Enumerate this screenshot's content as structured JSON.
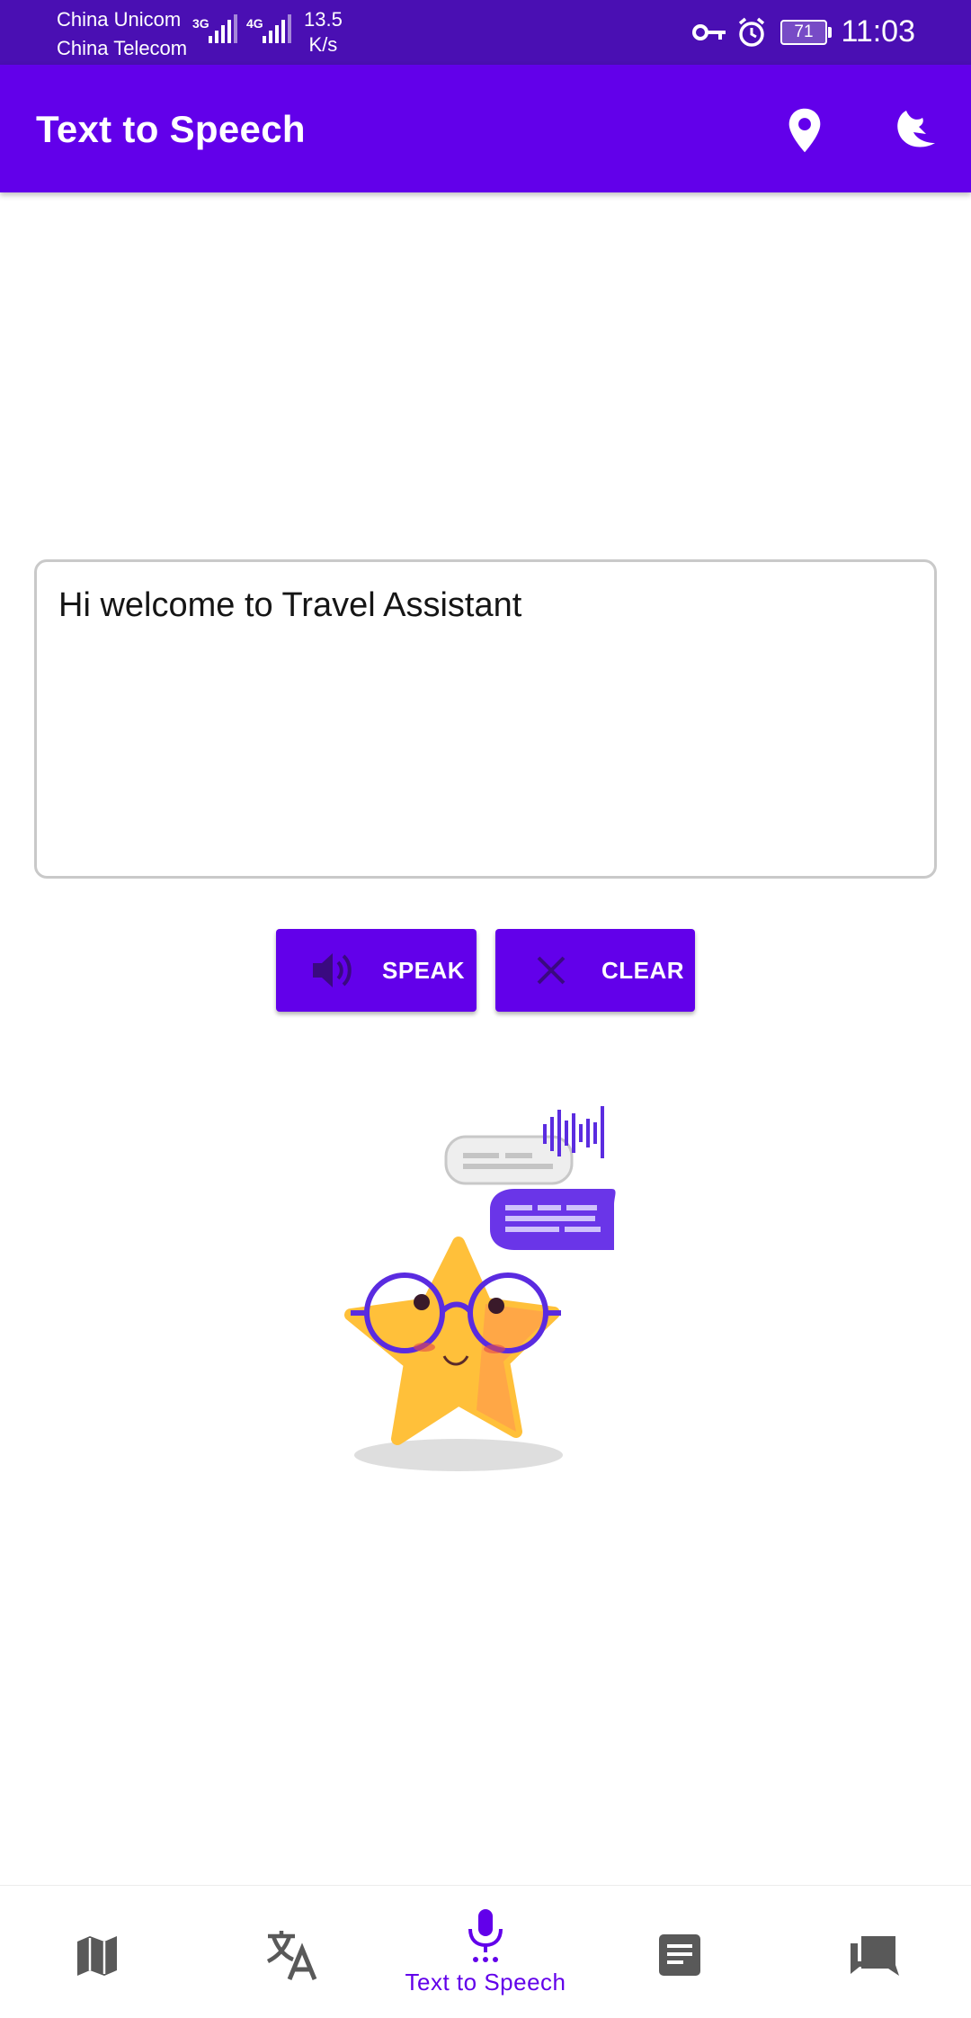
{
  "status_bar": {
    "carrier_1": "China Unicom",
    "carrier_2": "China Telecom",
    "net_1": "3G",
    "net_2": "4G",
    "speed_value": "13.5",
    "speed_unit": "K/s",
    "battery": "71",
    "time": "11:03"
  },
  "app_bar": {
    "title": "Text to Speech",
    "location_icon": "location-pin-icon",
    "theme_icon": "night-mode-icon"
  },
  "text_input": {
    "value": "Hi welcome to Travel Assistant"
  },
  "buttons": {
    "speak_label": "SPEAK",
    "clear_label": "CLEAR"
  },
  "bottom_nav": {
    "items": [
      {
        "icon": "map-icon",
        "label": ""
      },
      {
        "icon": "translate-icon",
        "label": ""
      },
      {
        "icon": "microphone-icon",
        "label": "Text to Speech",
        "active": true
      },
      {
        "icon": "document-icon",
        "label": ""
      },
      {
        "icon": "chat-icon",
        "label": ""
      }
    ]
  },
  "colors": {
    "primary": "#6200ea",
    "status_bar": "#4a0fb3",
    "inactive_icon": "#595959"
  }
}
